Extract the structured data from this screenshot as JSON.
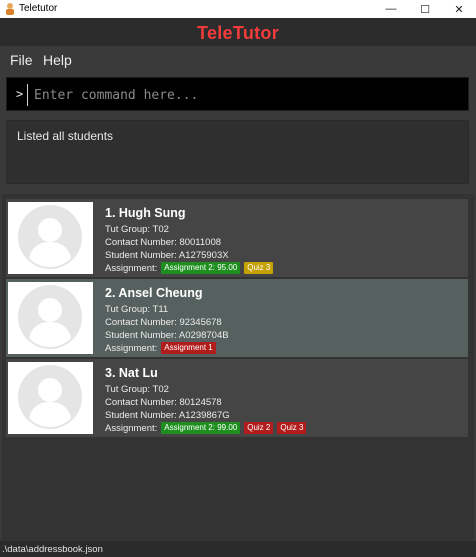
{
  "window": {
    "title": "Teletutor",
    "controls": {
      "minimize": "—",
      "maximize": "☐",
      "close": "✕"
    }
  },
  "app": {
    "brand": "TeleTutor",
    "brand_color": "#f23c3c"
  },
  "menu": {
    "items": [
      "File",
      "Help"
    ]
  },
  "command": {
    "prompt": ">",
    "placeholder": "Enter command here...",
    "value": ""
  },
  "result": {
    "message": "Listed all students"
  },
  "students": [
    {
      "name": "1. Hugh Sung",
      "tut_group": "Tut Group: T02",
      "contact": "Contact Number: 80011008",
      "student_number": "Student Number: A1275903X",
      "assignment_label": "Assignment:",
      "tags": [
        {
          "text": "Assignment 2: 95.00",
          "color": "#1e8f1e"
        },
        {
          "text": "Quiz 3",
          "color": "#c4a100"
        }
      ],
      "selected": false
    },
    {
      "name": "2. Ansel Cheung",
      "tut_group": "Tut Group: T11",
      "contact": "Contact Number: 92345678",
      "student_number": "Student Number: A0298704B",
      "assignment_label": "Assignment:",
      "tags": [
        {
          "text": "Assignment 1",
          "color": "#b11c1c"
        }
      ],
      "selected": true
    },
    {
      "name": "3. Nat Lu",
      "tut_group": "Tut Group: T02",
      "contact": "Contact Number: 80124578",
      "student_number": "Student Number: A1239867G",
      "assignment_label": "Assignment:",
      "tags": [
        {
          "text": "Assignment 2: 99.00",
          "color": "#1e8f1e"
        },
        {
          "text": "Quiz 2",
          "color": "#b11c1c"
        },
        {
          "text": "Quiz 3",
          "color": "#b11c1c"
        }
      ],
      "selected": false
    }
  ],
  "status": {
    "path": ".\\data\\addressbook.json"
  }
}
